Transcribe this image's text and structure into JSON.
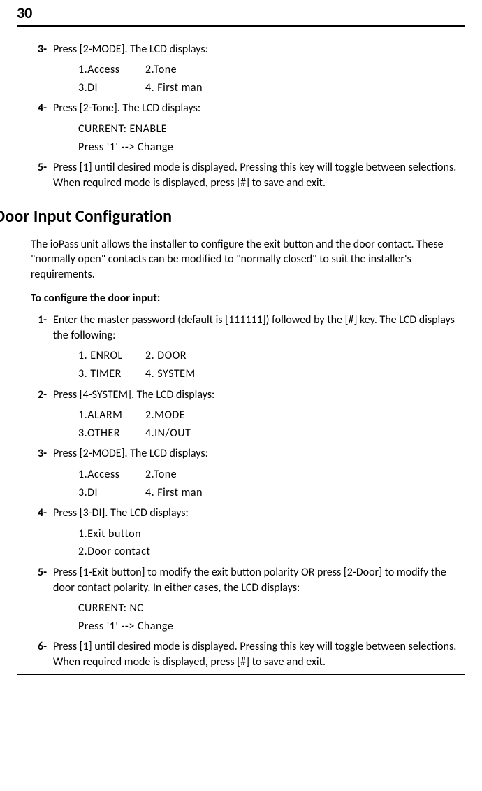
{
  "page_number": "30",
  "steps_a": {
    "s3": {
      "num": "3-",
      "text": "Press [2-MODE]. The LCD displays:",
      "menu": {
        "r1c1": "1.Access",
        "r1c2": "2.Tone",
        "r2c1": "3.DI",
        "r2c2": "4. First man"
      }
    },
    "s4": {
      "num": "4-",
      "text": "Press [2-Tone]. The LCD displays:",
      "line1": "CURRENT: ENABLE",
      "line2": "Press '1' --> Change"
    },
    "s5": {
      "num": "5-",
      "text": "Press [1] until desired mode is displayed. Pressing this key will toggle between selections. When required mode is displayed, press [#] to save and exit."
    }
  },
  "heading": "Door Input Configuration",
  "intro": "The ioPass unit allows the installer to configure the exit button and the door contact. These \"normally open\" contacts can be modified to \"normally closed\" to suit the installer's requirements.",
  "subhead": "To configure the door input:",
  "steps_b": {
    "s1": {
      "num": "1-",
      "text": "Enter the master password (default is [111111]) followed by the [#] key. The LCD displays the following:",
      "menu": {
        "r1c1": "1. ENROL",
        "r1c2": "2. DOOR",
        "r2c1": "3. TIMER",
        "r2c2": "4. SYSTEM"
      }
    },
    "s2": {
      "num": "2-",
      "text": "Press [4-SYSTEM]. The LCD displays:",
      "menu": {
        "r1c1": "1.ALARM",
        "r1c2": "2.MODE",
        "r2c1": "3.OTHER",
        "r2c2": "4.IN/OUT"
      }
    },
    "s3": {
      "num": "3-",
      "text": "Press [2-MODE]. The LCD displays:",
      "menu": {
        "r1c1": "1.Access",
        "r1c2": "2.Tone",
        "r2c1": "3.DI",
        "r2c2": "4. First man"
      }
    },
    "s4": {
      "num": "4-",
      "text": "Press [3-DI]. The LCD displays:",
      "line1": "1.Exit button",
      "line2": "2.Door contact"
    },
    "s5": {
      "num": "5-",
      "text": "Press [1-Exit button] to modify the exit button polarity OR press [2-Door] to modify the door contact polarity. In either cases, the LCD displays:",
      "line1": "CURRENT: NC",
      "line2": "Press '1' --> Change"
    },
    "s6": {
      "num": "6-",
      "text": "Press [1] until desired mode is displayed. Pressing this key will toggle between selections. When required mode is displayed, press [#] to save and exit."
    }
  }
}
